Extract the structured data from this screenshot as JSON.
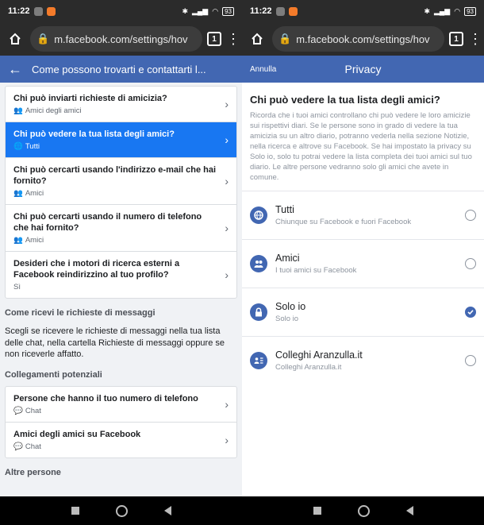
{
  "status": {
    "time": "11:22",
    "battery": "93"
  },
  "browser": {
    "url": "m.facebook.com/settings/hov",
    "tab_count": "1"
  },
  "left": {
    "header_title": "Come possono trovarti e contattarti l...",
    "rows": [
      {
        "q": "Chi può inviarti richieste di amicizia?",
        "v": "Amici degli amici"
      },
      {
        "q": "Chi può vedere la tua lista degli amici?",
        "v": "Tutti"
      },
      {
        "q": "Chi può cercarti usando l'indirizzo e-mail che hai fornito?",
        "v": "Amici"
      },
      {
        "q": "Chi può cercarti usando il numero di telefono che hai fornito?",
        "v": "Amici"
      },
      {
        "q": "Desideri che i motori di ricerca esterni a Facebook reindirizzino al tuo profilo?",
        "v": "Sì"
      }
    ],
    "section_messages": "Come ricevi le richieste di messaggi",
    "messages_text": "Scegli se ricevere le richieste di messaggi nella tua lista delle chat, nella cartella Richieste di messaggi oppure se non riceverle affatto.",
    "section_links": "Collegamenti potenziali",
    "link_rows": [
      {
        "q": "Persone che hanno il tuo numero di telefono",
        "v": "Chat"
      },
      {
        "q": "Amici degli amici su Facebook",
        "v": "Chat"
      }
    ],
    "section_more": "Altre persone"
  },
  "right": {
    "cancel": "Annulla",
    "title": "Privacy",
    "heading": "Chi può vedere la tua lista degli amici?",
    "description": "Ricorda che i tuoi amici controllano chi può vedere le loro amicizie sui rispettivi diari. Se le persone sono in grado di vedere la tua amicizia su un altro diario, potranno vederla nella sezione Notizie, nella ricerca e altrove su Facebook. Se hai impostato la privacy su Solo io, solo tu potrai vedere la lista completa dei tuoi amici sul tuo diario. Le altre persone vedranno solo gli amici che avete in comune.",
    "options": [
      {
        "label": "Tutti",
        "sub": "Chiunque su Facebook e fuori Facebook",
        "icon": "globe-icon",
        "selected": false
      },
      {
        "label": "Amici",
        "sub": "I tuoi amici su Facebook",
        "icon": "friends-icon",
        "selected": false
      },
      {
        "label": "Solo io",
        "sub": "Solo io",
        "icon": "lock-icon",
        "selected": true
      },
      {
        "label": "Colleghi Aranzulla.it",
        "sub": "Colleghi Aranzulla.it",
        "icon": "list-icon",
        "selected": false
      }
    ]
  },
  "colors": {
    "fb_blue": "#4267b2",
    "selected_row": "#1877f2"
  }
}
